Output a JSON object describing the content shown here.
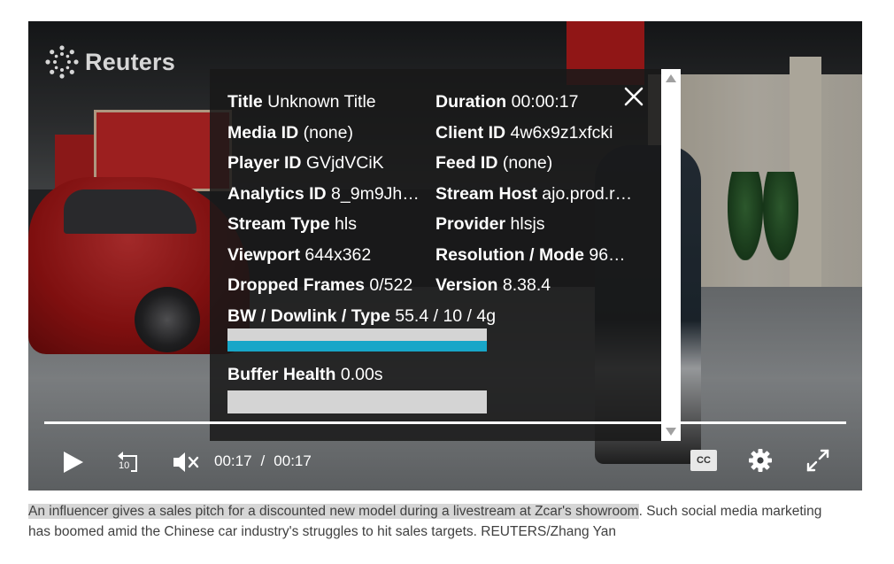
{
  "player": {
    "brand": "Reuters",
    "stats": {
      "rows": [
        [
          {
            "label": "Title",
            "value": "Unknown Title"
          },
          {
            "label": "Duration",
            "value": "00:00:17"
          }
        ],
        [
          {
            "label": "Media ID",
            "value": "(none)"
          },
          {
            "label": "Client ID",
            "value": "4w6x9z1xfcki"
          }
        ],
        [
          {
            "label": "Player ID",
            "value": "GVjdVCiK"
          },
          {
            "label": "Feed ID",
            "value": "(none)"
          }
        ],
        [
          {
            "label": "Analytics ID",
            "value": "8_9m9Jh…"
          },
          {
            "label": "Stream Host",
            "value": "ajo.prod.r…"
          }
        ],
        [
          {
            "label": "Stream Type",
            "value": "hls"
          },
          {
            "label": "Provider",
            "value": "hlsjs"
          }
        ],
        [
          {
            "label": "Viewport",
            "value": "644x362"
          },
          {
            "label": "Resolution / Mode",
            "value": "96…"
          }
        ],
        [
          {
            "label": "Dropped Frames",
            "value": "0/522"
          },
          {
            "label": "Version",
            "value": "8.38.4"
          }
        ]
      ],
      "bandwidth": {
        "label": "BW / Dowlink / Type",
        "value": "55.4 / 10 / 4g",
        "fill_fraction": 1.0
      },
      "buffer": {
        "label": "Buffer Health",
        "value": "0.00s",
        "fill_fraction": 0.0
      }
    },
    "controls": {
      "current_time": "00:17",
      "separator": "/",
      "total_time": "00:17",
      "rewind_seconds": "10",
      "cc_label": "CC"
    }
  },
  "caption": {
    "highlighted": "An influencer gives a sales pitch for a discounted new model during a livestream at Zcar's showroom",
    "rest": ". Such social media marketing has boomed amid the Chinese car industry's struggles to hit sales targets. REUTERS/Zhang Yan"
  }
}
